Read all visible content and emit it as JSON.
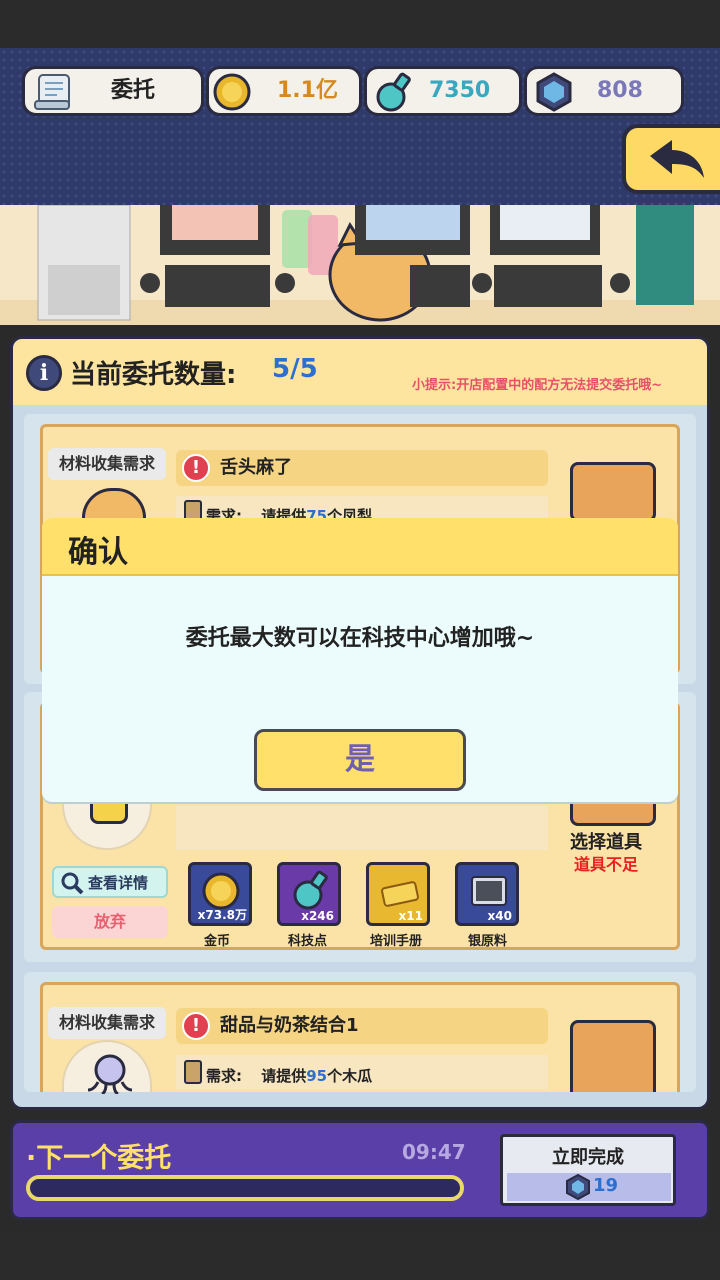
{
  "header": {
    "commission_label": "委托",
    "gold": "1.1亿",
    "tech_points": "7350",
    "gems": "808"
  },
  "panel": {
    "count_label": "当前委托数量:",
    "count_value": "5/5",
    "hint": "小提示:开店配置中的配方无法提交委托哦~"
  },
  "cards": [
    {
      "type_tag": "材料收集需求",
      "title": "舌头麻了",
      "req_prefix": "需求:",
      "req_text_a": "请提供",
      "req_num": "75",
      "req_text_b": "个凤梨"
    },
    {
      "view_detail": "查看详情",
      "abandon": "放弃",
      "select_item": "选择道具",
      "item_short": "道具不足",
      "rewards": [
        {
          "icon": "gold-coin-icon",
          "count": "x73.8万",
          "label": "金币"
        },
        {
          "icon": "tech-flask-icon",
          "count": "x246",
          "label": "科技点"
        },
        {
          "icon": "training-book-icon",
          "count": "x11",
          "label": "培训手册"
        },
        {
          "icon": "silver-material-icon",
          "count": "x40",
          "label": "银原料"
        }
      ]
    },
    {
      "type_tag": "材料收集需求",
      "title": "甜品与奶茶结合1",
      "req_prefix": "需求:",
      "req_text_a": "请提供",
      "req_num": "95",
      "req_text_b": "个木瓜"
    }
  ],
  "dialog": {
    "title": "确认",
    "message": "委托最大数可以在科技中心增加哦~",
    "confirm": "是"
  },
  "next": {
    "label": "·下一个委托",
    "timer": "09:47",
    "finish_label": "立即完成",
    "finish_cost": "19"
  },
  "colors": {
    "accent_yellow": "#ffe06a",
    "purple": "#5b3fa8",
    "navy": "#2f3a6b",
    "hint_red": "#e8506a",
    "count_blue": "#2d6fd0"
  }
}
